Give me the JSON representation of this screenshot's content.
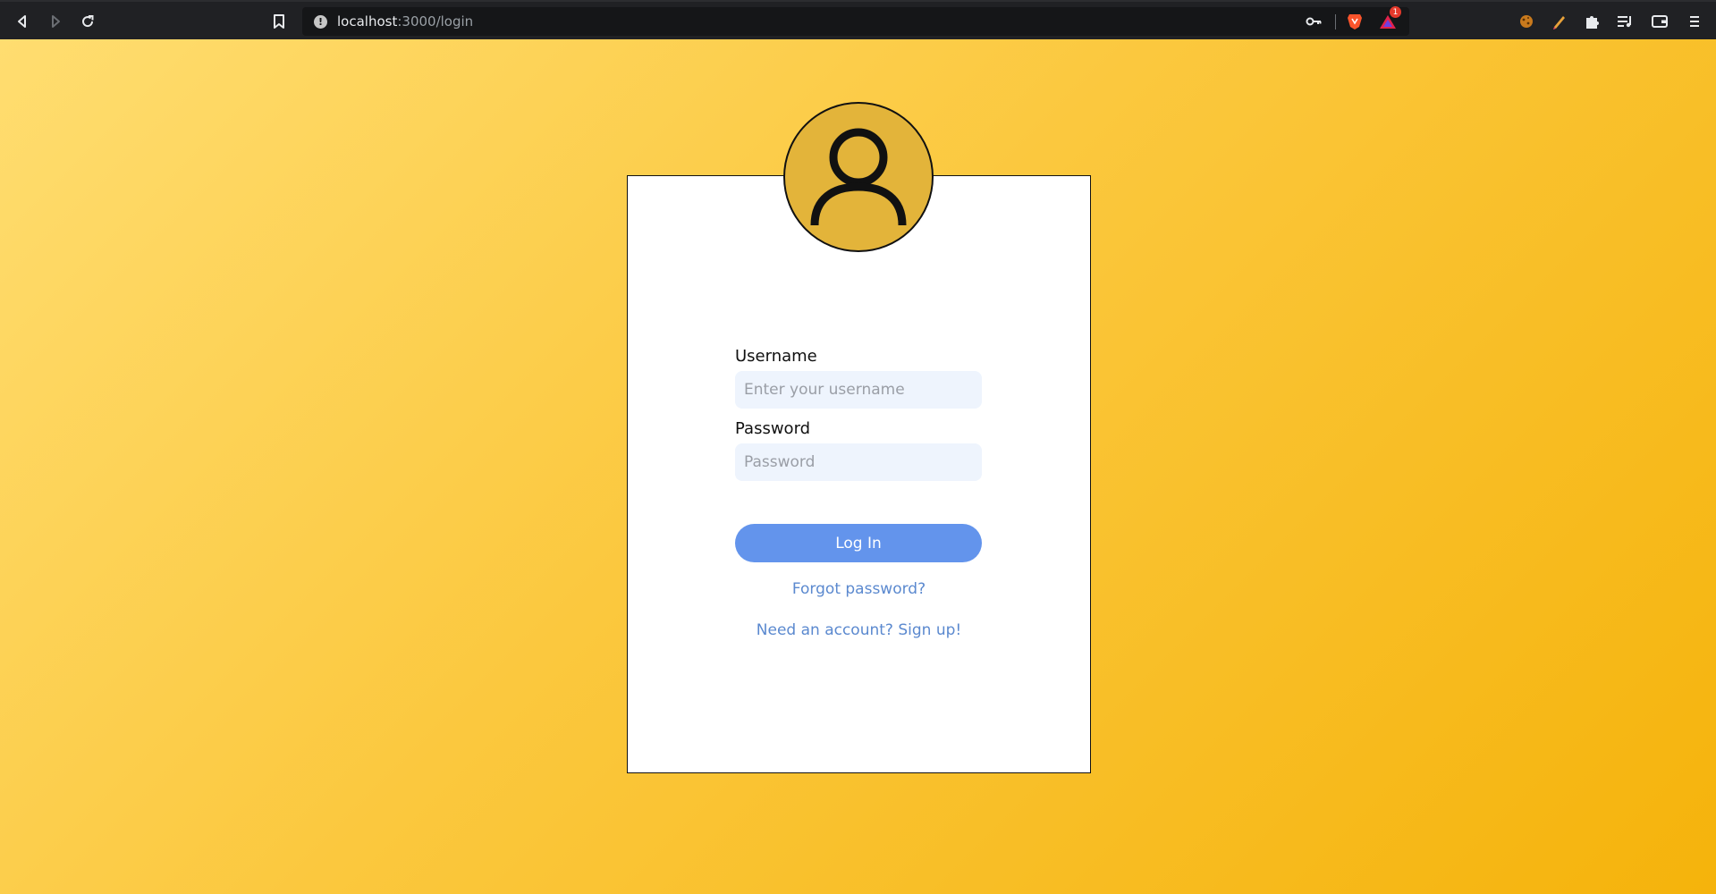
{
  "browser": {
    "url_host": "localhost",
    "url_path": ":3000/login",
    "notification_badge": "1",
    "icons": {
      "back": "back-arrow-icon",
      "forward": "forward-arrow-icon",
      "reload": "reload-icon",
      "bookmark": "bookmark-icon",
      "site_info": "info-icon",
      "password_key": "key-icon",
      "brave_shield": "brave-shield-icon",
      "brave_rewards": "brave-rewards-icon",
      "extensions": [
        "cookie-extension-icon",
        "pen-extension-icon",
        "puzzle-extensions-icon",
        "playlist-icon",
        "wallet-icon",
        "menu-icon"
      ]
    }
  },
  "page": {
    "background_colors": [
      "#ffdd70",
      "#f5b30b"
    ],
    "avatar_color": "#e3b43a",
    "avatar_icon": "user-icon"
  },
  "login_form": {
    "username_label": "Username",
    "username_placeholder": "Enter your username",
    "password_label": "Password",
    "password_placeholder": "Password",
    "submit_label": "Log In",
    "forgot_password_link": "Forgot password?",
    "signup_link": "Need an account? Sign up!",
    "accent_color": "#6394ec"
  }
}
